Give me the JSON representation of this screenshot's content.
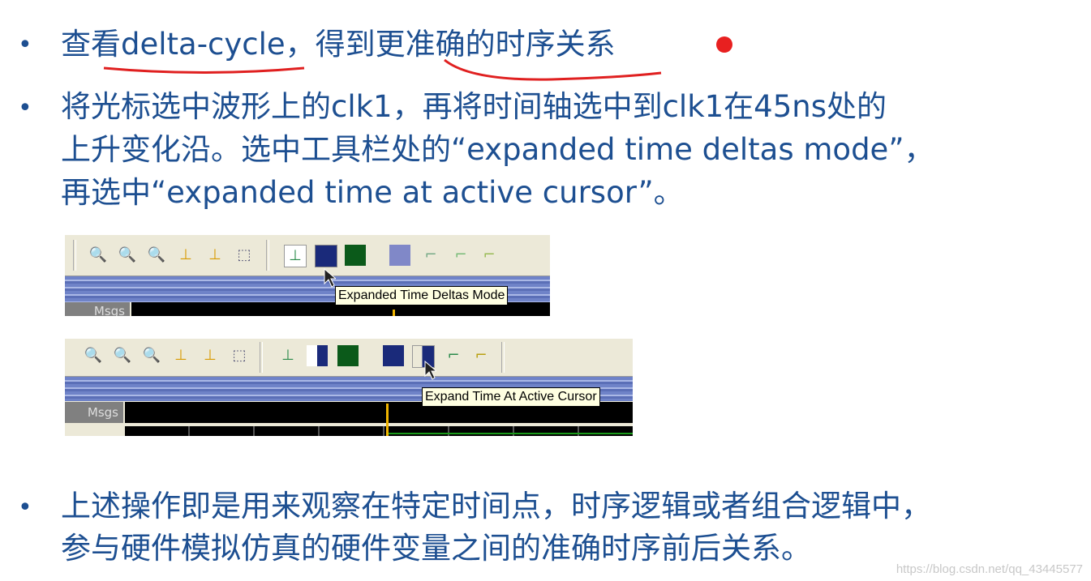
{
  "bullets": [
    {
      "lines": [
        "查看delta-cycle，得到更准确的时序关系"
      ]
    },
    {
      "lines": [
        "将光标选中波形上的clk1，再将时间轴选中到clk1在45ns处的",
        "上升变化沿。选中工具栏处的“expanded time deltas mode”，",
        "再选中“expanded time at active cursor”。"
      ]
    },
    {
      "lines": [
        "上述操作即是用来观察在特定时间点，时序逻辑或者组合逻辑中，",
        "参与硬件模拟仿真的硬件变量之间的准确时序前后关系。"
      ]
    }
  ],
  "bullet_symbol": "•",
  "screenshots": [
    {
      "tooltip": "Expanded Time Deltas Mode",
      "msgs_label": "Msgs"
    },
    {
      "tooltip": "Expand Time At Active Cursor",
      "msgs_label": "Msgs"
    }
  ],
  "toolbar_icons": [
    "zoom-in-icon",
    "zoom-out-icon",
    "zoom-full-icon",
    "zoom-cursor-icon",
    "zoom-cursors-icon",
    "zoom-region-icon",
    "collapsed-time-icon",
    "expanded-time-deltas-icon",
    "expanded-events-icon",
    "expand-all-icon",
    "expand-at-cursor-icon",
    "collapse-at-cursor-icon",
    "collapse-all-icon"
  ],
  "watermark": "https://blog.csdn.net/qq_43445577",
  "colors": {
    "text": "#1d4f91",
    "annotation": "#e02020",
    "cursor": "#f0b400"
  }
}
